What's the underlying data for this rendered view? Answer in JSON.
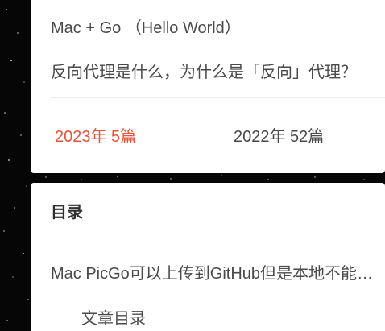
{
  "recent_posts": [
    {
      "title": "Mac + Go （Hello World）"
    },
    {
      "title": "反向代理是什么，为什么是「反向」代理？"
    }
  ],
  "archives": [
    {
      "label": "2023年  5篇",
      "highlighted": true
    },
    {
      "label": "2022年  52篇",
      "highlighted": false
    }
  ],
  "toc": {
    "title": "目录",
    "items": [
      {
        "label": "Mac PicGo可以上传到GitHub但是本地不能预览问题"
      },
      {
        "label": "文章目录"
      }
    ]
  },
  "colors": {
    "accent": "#e8533a",
    "text": "#4a4a4a",
    "background": "#060606",
    "card": "#ffffff"
  }
}
